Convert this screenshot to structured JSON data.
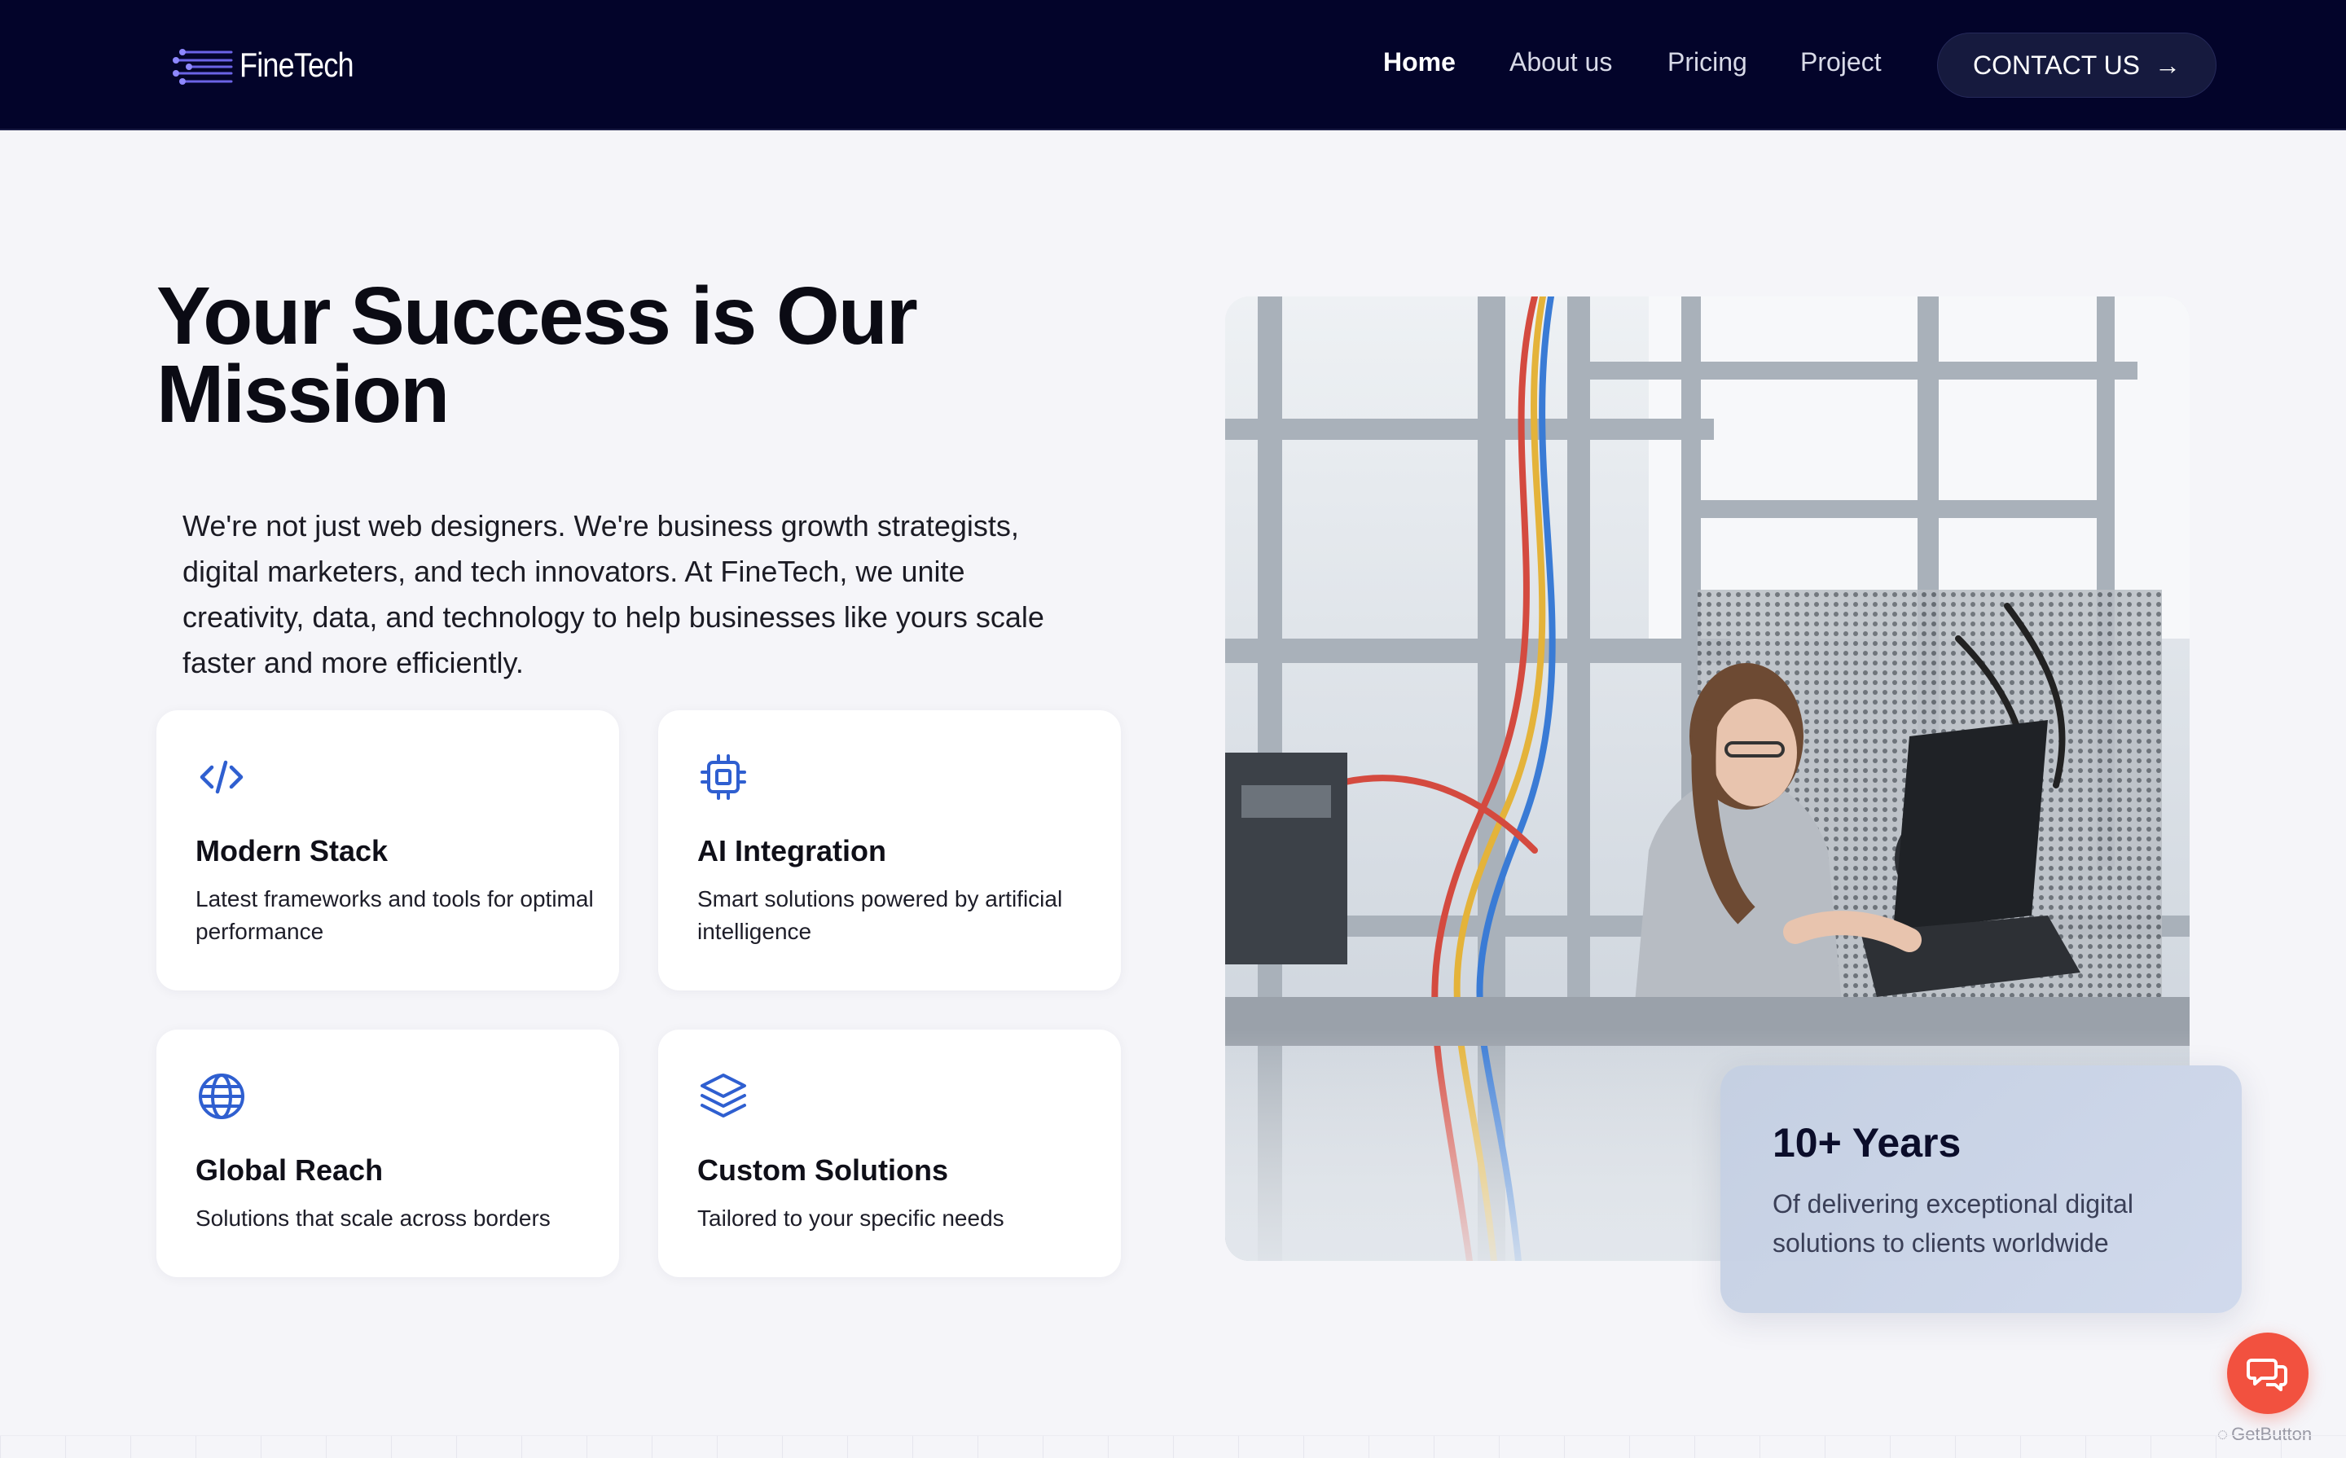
{
  "brand": {
    "name": "FineTech",
    "logo_icon": "circuit-lines-logo"
  },
  "nav": {
    "items": [
      {
        "label": "Home",
        "active": true
      },
      {
        "label": "About us",
        "active": false
      },
      {
        "label": "Pricing",
        "active": false
      },
      {
        "label": "Project",
        "active": false
      }
    ],
    "cta_label": "CONTACT US",
    "cta_icon": "arrow-right-icon"
  },
  "hero": {
    "title_line1": "Your Success is Our",
    "title_line2": "Mission",
    "description": "We're not just web designers. We're business growth strategists, digital marketers, and tech innovators. At FineTech, we unite creativity, data, and technology to help businesses like yours scale faster and more efficiently."
  },
  "features": [
    {
      "icon": "code-icon",
      "title": "Modern Stack",
      "desc": "Latest frameworks and tools for optimal performance"
    },
    {
      "icon": "cpu-chip-icon",
      "title": "AI Integration",
      "desc": "Smart solutions powered by artificial intelligence"
    },
    {
      "icon": "globe-icon",
      "title": "Global Reach",
      "desc": "Solutions that scale across borders"
    },
    {
      "icon": "layers-icon",
      "title": "Custom Solutions",
      "desc": "Tailored to your specific needs"
    }
  ],
  "stat": {
    "title": "10+ Years",
    "desc": "Of delivering exceptional digital solutions to clients worldwide"
  },
  "widget": {
    "chat_icon": "chat-bubbles-icon",
    "brand": "GetButton"
  },
  "colors": {
    "nav_bg": "#03042a",
    "accent_blue": "#2f5fd0",
    "chat_red": "#f2513f",
    "page_bg": "#f5f5f9"
  }
}
